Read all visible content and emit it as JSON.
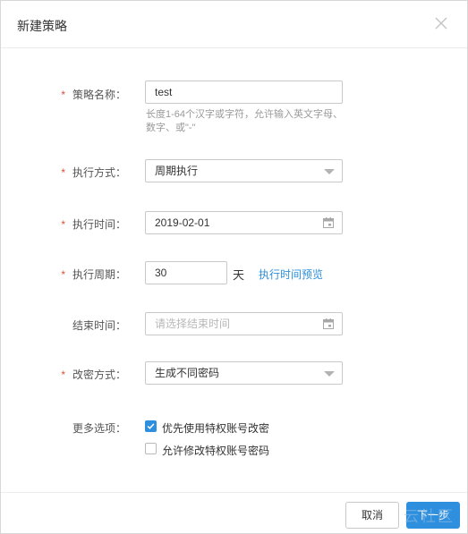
{
  "dialog": {
    "title": "新建策略"
  },
  "form": {
    "required_mark": "*",
    "strategy_name": {
      "label": "策略名称：",
      "value": "test",
      "hint": "长度1-64个汉字或字符，允许输入英文字母、 数字、或\"-\""
    },
    "exec_mode": {
      "label": "执行方式：",
      "value": "周期执行"
    },
    "exec_time": {
      "label": "执行时间：",
      "value": "2019-02-01"
    },
    "exec_period": {
      "label": "执行周期：",
      "value": "30",
      "unit": "天",
      "preview_link": "执行时间预览"
    },
    "end_time": {
      "label": "结束时间：",
      "placeholder": "请选择结束时间"
    },
    "change_mode": {
      "label": "改密方式：",
      "value": "生成不同密码"
    },
    "more_options": {
      "label": "更多选项：",
      "options": [
        {
          "label": "优先使用特权账号改密",
          "checked": true
        },
        {
          "label": "允许修改特权账号密码",
          "checked": false
        }
      ]
    }
  },
  "footer": {
    "cancel_label": "取消",
    "next_label": "下一步"
  },
  "watermark": "云社区",
  "colors": {
    "accent": "#2d8fdd",
    "required": "#e04b3a"
  }
}
